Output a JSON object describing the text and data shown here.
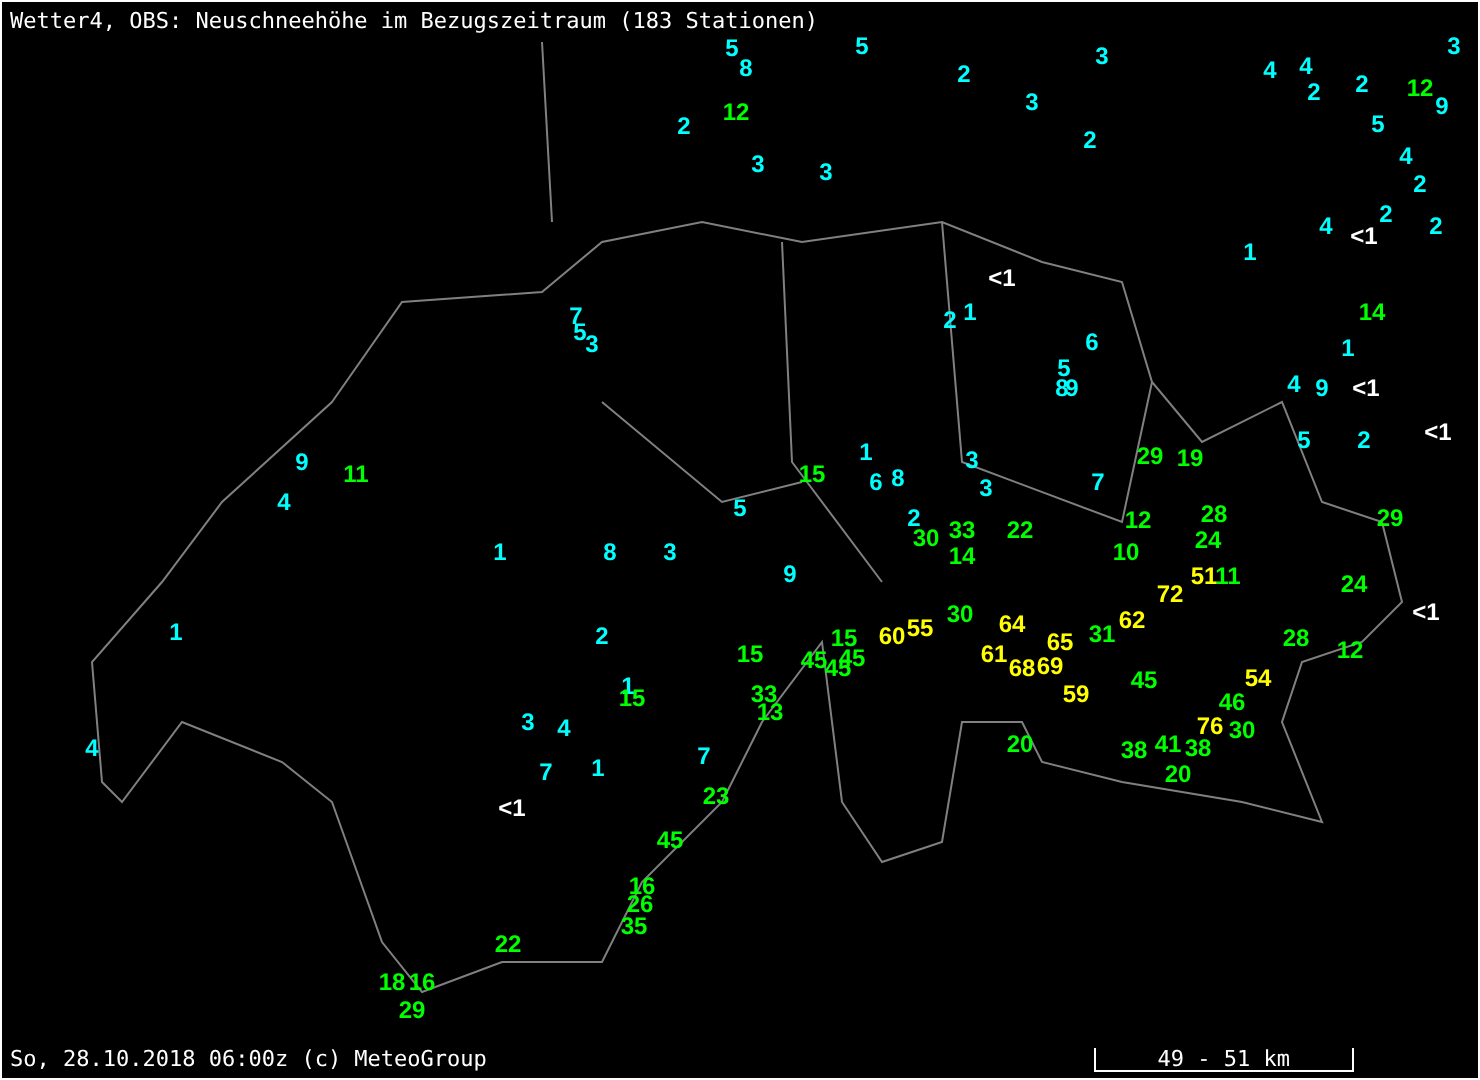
{
  "title": "Wetter4, OBS: Neuschneehöhe im Bezugszeitraum (183 Stationen)",
  "stations": [
    {
      "text": "5",
      "color": "#00ffff"
    },
    {
      "text": "8",
      "color": "#00ffff"
    },
    {
      "text": "2",
      "color": "#00ffff"
    },
    {
      "text": "12",
      "color": "#00ff00"
    },
    {
      "text": "5",
      "color": "#00ffff"
    },
    {
      "text": "2",
      "color": "#00ffff"
    },
    {
      "text": "3",
      "color": "#00ffff"
    },
    {
      "text": "3",
      "color": "#00ffff"
    },
    {
      "text": "4",
      "color": "#00ffff"
    },
    {
      "text": "4",
      "color": "#00ffff"
    },
    {
      "text": "3",
      "color": "#00ffff"
    },
    {
      "text": "2",
      "color": "#00ffff"
    },
    {
      "text": "2",
      "color": "#00ffff"
    },
    {
      "text": "5",
      "color": "#00ffff"
    },
    {
      "text": "12",
      "color": "#00ff00"
    },
    {
      "text": "9",
      "color": "#00ffff"
    },
    {
      "text": "2",
      "color": "#00ffff"
    },
    {
      "text": "3",
      "color": "#00ffff"
    },
    {
      "text": "3",
      "color": "#00ffff"
    },
    {
      "text": "4",
      "color": "#00ffff"
    },
    {
      "text": "2",
      "color": "#00ffff"
    },
    {
      "text": "2",
      "color": "#00ffff"
    },
    {
      "text": "4",
      "color": "#00ffff"
    },
    {
      "text": "<1",
      "color": "#ffffff"
    },
    {
      "text": "2",
      "color": "#00ffff"
    },
    {
      "text": "1",
      "color": "#00ffff"
    },
    {
      "text": "<1",
      "color": "#ffffff"
    },
    {
      "text": "7",
      "color": "#00ffff"
    },
    {
      "text": "2",
      "color": "#00ffff"
    },
    {
      "text": "1",
      "color": "#00ffff"
    },
    {
      "text": "14",
      "color": "#00ff00"
    },
    {
      "text": "5",
      "color": "#00ffff"
    },
    {
      "text": "3",
      "color": "#00ffff"
    },
    {
      "text": "6",
      "color": "#00ffff"
    },
    {
      "text": "1",
      "color": "#00ffff"
    },
    {
      "text": "5",
      "color": "#00ffff"
    },
    {
      "text": "8",
      "color": "#00ffff"
    },
    {
      "text": "9",
      "color": "#00ffff"
    },
    {
      "text": "4",
      "color": "#00ffff"
    },
    {
      "text": "9",
      "color": "#00ffff"
    },
    {
      "text": "<1",
      "color": "#ffffff"
    },
    {
      "text": "5",
      "color": "#00ffff"
    },
    {
      "text": "2",
      "color": "#00ffff"
    },
    {
      "text": "<1",
      "color": "#ffffff"
    },
    {
      "text": "9",
      "color": "#00ffff"
    },
    {
      "text": "1",
      "color": "#00ffff"
    },
    {
      "text": "3",
      "color": "#00ffff"
    },
    {
      "text": "29",
      "color": "#00ff00"
    },
    {
      "text": "19",
      "color": "#00ff00"
    },
    {
      "text": "11",
      "color": "#00ff00"
    },
    {
      "text": "15",
      "color": "#00ff00"
    },
    {
      "text": "6",
      "color": "#00ffff"
    },
    {
      "text": "8",
      "color": "#00ffff"
    },
    {
      "text": "3",
      "color": "#00ffff"
    },
    {
      "text": "7",
      "color": "#00ffff"
    },
    {
      "text": "4",
      "color": "#00ffff"
    },
    {
      "text": "5",
      "color": "#00ffff"
    },
    {
      "text": "2",
      "color": "#00ffff"
    },
    {
      "text": "30",
      "color": "#00ff00"
    },
    {
      "text": "33",
      "color": "#00ff00"
    },
    {
      "text": "22",
      "color": "#00ff00"
    },
    {
      "text": "12",
      "color": "#00ff00"
    },
    {
      "text": "28",
      "color": "#00ff00"
    },
    {
      "text": "24",
      "color": "#00ff00"
    },
    {
      "text": "29",
      "color": "#00ff00"
    },
    {
      "text": "1",
      "color": "#00ffff"
    },
    {
      "text": "8",
      "color": "#00ffff"
    },
    {
      "text": "3",
      "color": "#00ffff"
    },
    {
      "text": "14",
      "color": "#00ff00"
    },
    {
      "text": "10",
      "color": "#00ff00"
    },
    {
      "text": "9",
      "color": "#00ffff"
    },
    {
      "text": "72",
      "color": "#ffff00"
    },
    {
      "text": "51",
      "color": "#ffff00"
    },
    {
      "text": "11",
      "color": "#00ff00"
    },
    {
      "text": "24",
      "color": "#00ff00"
    },
    {
      "text": "1",
      "color": "#00ffff"
    },
    {
      "text": "2",
      "color": "#00ffff"
    },
    {
      "text": "15",
      "color": "#00ff00"
    },
    {
      "text": "45",
      "color": "#00ff00"
    },
    {
      "text": "15",
      "color": "#00ff00"
    },
    {
      "text": "45",
      "color": "#00ff00"
    },
    {
      "text": "45",
      "color": "#00ff00"
    },
    {
      "text": "60",
      "color": "#ffff00"
    },
    {
      "text": "55",
      "color": "#ffff00"
    },
    {
      "text": "30",
      "color": "#00ff00"
    },
    {
      "text": "64",
      "color": "#ffff00"
    },
    {
      "text": "61",
      "color": "#ffff00"
    },
    {
      "text": "65",
      "color": "#ffff00"
    },
    {
      "text": "68",
      "color": "#ffff00"
    },
    {
      "text": "69",
      "color": "#ffff00"
    },
    {
      "text": "31",
      "color": "#00ff00"
    },
    {
      "text": "62",
      "color": "#ffff00"
    },
    {
      "text": "28",
      "color": "#00ff00"
    },
    {
      "text": "12",
      "color": "#00ff00"
    },
    {
      "text": "<1",
      "color": "#ffffff"
    },
    {
      "text": "3",
      "color": "#00ffff"
    },
    {
      "text": "4",
      "color": "#00ffff"
    },
    {
      "text": "1",
      "color": "#00ffff"
    },
    {
      "text": "15",
      "color": "#00ff00"
    },
    {
      "text": "33",
      "color": "#00ff00"
    },
    {
      "text": "13",
      "color": "#00ff00"
    },
    {
      "text": "59",
      "color": "#ffff00"
    },
    {
      "text": "45",
      "color": "#00ff00"
    },
    {
      "text": "54",
      "color": "#ffff00"
    },
    {
      "text": "46",
      "color": "#00ff00"
    },
    {
      "text": "76",
      "color": "#ffff00"
    },
    {
      "text": "30",
      "color": "#00ff00"
    },
    {
      "text": "4",
      "color": "#00ffff"
    },
    {
      "text": "7",
      "color": "#00ffff"
    },
    {
      "text": "1",
      "color": "#00ffff"
    },
    {
      "text": "7",
      "color": "#00ffff"
    },
    {
      "text": "20",
      "color": "#00ff00"
    },
    {
      "text": "38",
      "color": "#00ff00"
    },
    {
      "text": "41",
      "color": "#00ff00"
    },
    {
      "text": "38",
      "color": "#00ff00"
    },
    {
      "text": "20",
      "color": "#00ff00"
    },
    {
      "text": "<1",
      "color": "#ffffff"
    },
    {
      "text": "23",
      "color": "#00ff00"
    },
    {
      "text": "45",
      "color": "#00ff00"
    },
    {
      "text": "16",
      "color": "#00ff00"
    },
    {
      "text": "26",
      "color": "#00ff00"
    },
    {
      "text": "35",
      "color": "#00ff00"
    },
    {
      "text": "22",
      "color": "#00ff00"
    },
    {
      "text": "18",
      "color": "#00ff00"
    },
    {
      "text": "16",
      "color": "#00ff00"
    },
    {
      "text": "29",
      "color": "#00ff00"
    }
  ],
  "footer": "So, 28.10.2018 06:00z (c) MeteoGroup",
  "scale": "49 - 51 km"
}
